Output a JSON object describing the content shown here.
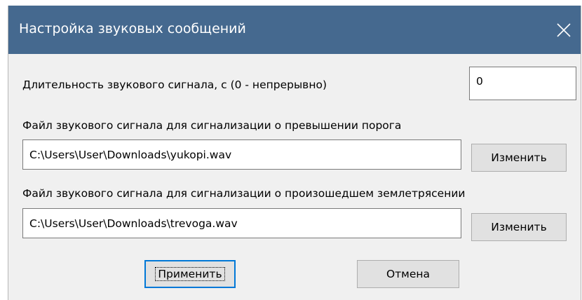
{
  "window": {
    "title": "Настройка звуковых сообщений",
    "close_icon": "close-icon"
  },
  "duration": {
    "label": "Длительность звукового сигнала, с (0 - непрерывно)",
    "value": "0"
  },
  "threshold_file": {
    "label": "Файл звукового сигнала для сигнализации о превышении порога",
    "value": "C:\\Users\\User\\Downloads\\yukopi.wav",
    "change_label": "Изменить"
  },
  "earthquake_file": {
    "label": "Файл звукового сигнала для сигнализации о произошедшем землетрясении",
    "value": "C:\\Users\\User\\Downloads\\trevoga.wav",
    "change_label": "Изменить"
  },
  "buttons": {
    "apply_label": "Применить",
    "cancel_label": "Отмена"
  },
  "colors": {
    "titlebar": "#45698f",
    "dialog_bg": "#f0f0f0",
    "button_bg": "#e1e1e1",
    "focus_border": "#0078d7"
  }
}
